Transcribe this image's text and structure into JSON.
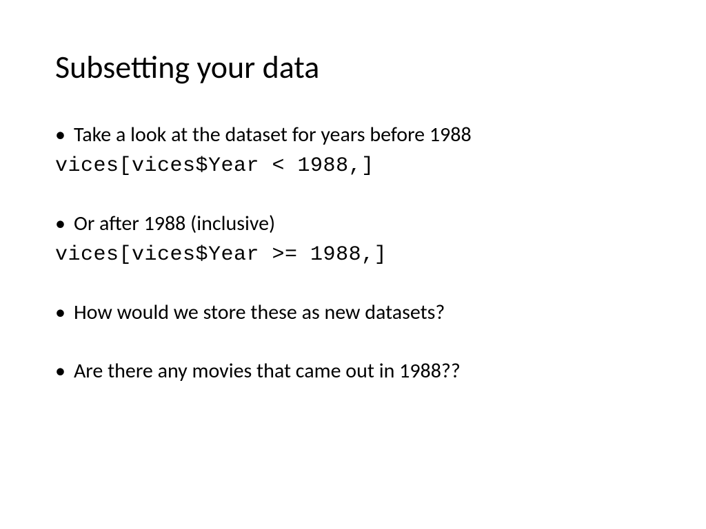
{
  "title": "Subsetting your data",
  "bullets": [
    {
      "text": "Take a look at the dataset for years before 1988",
      "code": "vices[vices$Year < 1988,]"
    },
    {
      "text": "Or after 1988 (inclusive)",
      "code": "vices[vices$Year >= 1988,]"
    },
    {
      "text": "How would we store these as new datasets?",
      "code": null
    },
    {
      "text": "Are there any movies that came out in 1988??",
      "code": null
    }
  ]
}
